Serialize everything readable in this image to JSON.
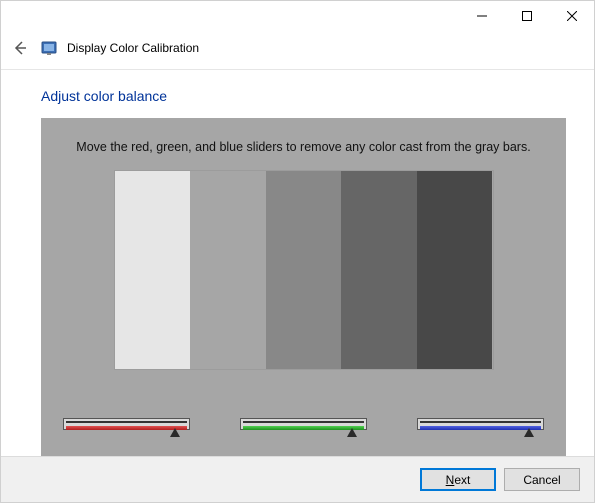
{
  "titlebar": {
    "minimize_glyph": "minimize",
    "maximize_glyph": "maximize",
    "close_glyph": "close"
  },
  "header": {
    "title": "Display Color Calibration"
  },
  "page": {
    "title": "Adjust color balance",
    "instruction": "Move the red, green, and blue sliders to remove any color cast from the gray bars."
  },
  "bars": {
    "shades": [
      "#e6e6e6",
      "#a6a6a6",
      "#888888",
      "#666666",
      "#484848"
    ]
  },
  "sliders": {
    "red": {
      "position_pct": 88
    },
    "green": {
      "position_pct": 88
    },
    "blue": {
      "position_pct": 88
    }
  },
  "footer": {
    "next_mnemonic": "N",
    "next_rest": "ext",
    "cancel_label": "Cancel"
  }
}
